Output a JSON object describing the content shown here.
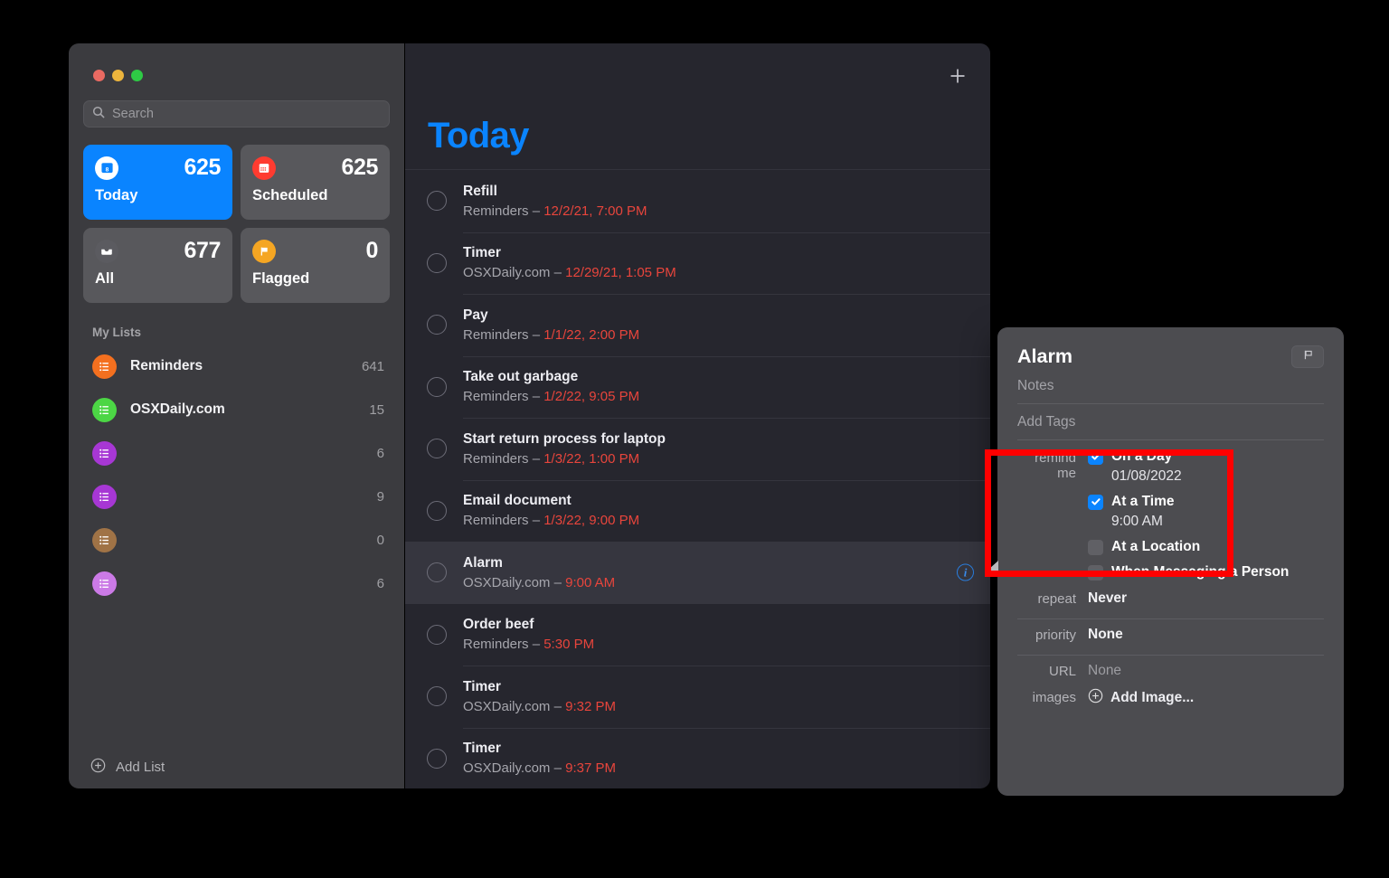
{
  "window": {
    "traffic_lights": [
      "close",
      "minimize",
      "zoom"
    ]
  },
  "sidebar": {
    "search": {
      "placeholder": "Search",
      "value": "",
      "icon": "search-icon"
    },
    "smart_cards": [
      {
        "label": "Today",
        "count": "625",
        "icon": "today-calendar-icon",
        "active": true,
        "color": "#0a84ff"
      },
      {
        "label": "Scheduled",
        "count": "625",
        "icon": "scheduled-calendar-icon",
        "active": false,
        "color": "#ff3b30"
      },
      {
        "label": "All",
        "count": "677",
        "icon": "all-tray-icon",
        "active": false,
        "color": "#5b5b60"
      },
      {
        "label": "Flagged",
        "count": "0",
        "icon": "flag-icon",
        "active": false,
        "color": "#f5a623"
      }
    ],
    "lists_header": "My Lists",
    "lists": [
      {
        "name": "Reminders",
        "count": "641",
        "color": "#f4701f"
      },
      {
        "name": "OSXDaily.com",
        "count": "15",
        "color": "#4cd645"
      },
      {
        "name": "",
        "count": "6",
        "color": "#a737d4"
      },
      {
        "name": "",
        "count": "9",
        "color": "#a737d4"
      },
      {
        "name": "",
        "count": "0",
        "color": "#a07346"
      },
      {
        "name": "",
        "count": "6",
        "color": "#cb7ae6"
      }
    ],
    "add_list_label": "Add List",
    "add_list_icon": "plus-circle-icon"
  },
  "content": {
    "title": "Today",
    "add_button_icon": "plus-icon",
    "reminders": [
      {
        "title": "Refill",
        "list": "Reminders",
        "date": "12/2/21, 7:00 PM",
        "selected": false,
        "has_info": false
      },
      {
        "title": "Timer",
        "list": "OSXDaily.com",
        "date": "12/29/21, 1:05 PM",
        "selected": false,
        "has_info": false
      },
      {
        "title": "Pay",
        "list": "Reminders",
        "date": "1/1/22, 2:00 PM",
        "selected": false,
        "has_info": false
      },
      {
        "title": "Take out garbage",
        "list": "Reminders",
        "date": "1/2/22, 9:05 PM",
        "selected": false,
        "has_info": false
      },
      {
        "title": "Start return process for laptop",
        "list": "Reminders",
        "date": "1/3/22, 1:00 PM",
        "selected": false,
        "has_info": false
      },
      {
        "title": "Email document",
        "list": "Reminders",
        "date": "1/3/22, 9:00 PM",
        "selected": false,
        "has_info": false
      },
      {
        "title": "Alarm",
        "list": "OSXDaily.com",
        "date": "9:00 AM",
        "selected": true,
        "has_info": true
      },
      {
        "title": "Order beef",
        "list": "Reminders",
        "date": "5:30 PM",
        "selected": false,
        "has_info": false
      },
      {
        "title": "Timer",
        "list": "OSXDaily.com",
        "date": "9:32 PM",
        "selected": false,
        "has_info": false
      },
      {
        "title": "Timer",
        "list": "OSXDaily.com",
        "date": "9:37 PM",
        "selected": false,
        "has_info": false
      }
    ],
    "separator": "–"
  },
  "popover": {
    "title": "Alarm",
    "flag_icon": "flag-outline-icon",
    "notes_placeholder": "Notes",
    "tags_placeholder": "Add Tags",
    "remind_me_label": "remind me",
    "on_a_day": {
      "label": "On a Day",
      "checked": true,
      "value": "01/08/2022"
    },
    "at_a_time": {
      "label": "At a Time",
      "checked": true,
      "value": "9:00 AM"
    },
    "at_a_location": {
      "label": "At a Location",
      "checked": false
    },
    "when_messaging": {
      "label": "When Messaging a Person",
      "checked": false
    },
    "repeat_label": "repeat",
    "repeat_value": "Never",
    "priority_label": "priority",
    "priority_value": "None",
    "url_label": "URL",
    "url_value": "None",
    "images_label": "images",
    "add_image_label": "Add Image...",
    "add_image_icon": "plus-circle-icon"
  },
  "annotation": {
    "highlight_color": "#ff0000",
    "target": "remind-me-date-time-section"
  }
}
